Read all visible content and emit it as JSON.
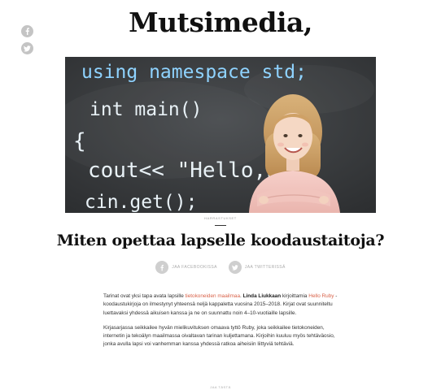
{
  "site": {
    "logo": "Mutsimedia,"
  },
  "side_share": {
    "icons": [
      "facebook-icon",
      "twitter-icon"
    ]
  },
  "hero": {
    "code_lines": [
      "using namespace std;",
      "int main()",
      "{",
      "cout<< \"Hello,Wo",
      "cin.get();"
    ]
  },
  "article": {
    "category": "Harrastukset",
    "title": "Miten opettaa lapselle koodaustaitoja?",
    "share": {
      "facebook": "Jaa Facebookissa",
      "twitter": "Jaa Twitterissä"
    },
    "p1": {
      "t1": "Tarinat ovat yksi tapa avata lapsille ",
      "link1": "tietokoneiden maailmaa",
      "t2": ". ",
      "author": "Linda Liukkaan",
      "t3": " kirjoittamia ",
      "link2": "Hello Ruby",
      "t4": " -koodaustukirjoja on ilmestynyt yhteensä neljä kappaletta vuosina 2015–2018. Kirjat ovat suunniteltu luettavaksi yhdessä aikuisen kanssa ja ne on suunnattu noin 4–10-vuotiaille lapsille."
    },
    "p2": "Kirjasarjassa seikkailee hyvän mielikuvituksen omaava tyttö Ruby, joka seikkailee tietokoneiden, internetin ja tekoälyn maailmassa oivaltavan tarinan kuljettamana. Kirjoihin kuuluu myös tehtäväosio, jonka avulla lapsi voi vanhemman kanssa yhdessä ratkoa aiheisiin liittyviä tehtäviä.",
    "bottom_label": "Jaa tästä"
  },
  "colors": {
    "accent_link": "#d9634a",
    "chalkboard": "#3a3c3e",
    "icon_gray": "#c4c4c4"
  }
}
